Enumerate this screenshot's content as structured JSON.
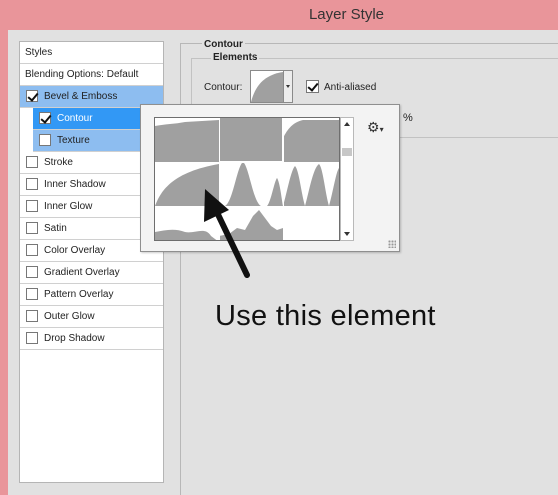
{
  "window": {
    "title": "Layer Style"
  },
  "sidebar": {
    "header": "Styles",
    "blending_options": "Blending Options: Default",
    "items": [
      {
        "label": "Bevel & Emboss",
        "checked": true,
        "selected": true,
        "indent": false
      },
      {
        "label": "Contour",
        "checked": true,
        "selected": true,
        "indent": true
      },
      {
        "label": "Texture",
        "checked": false,
        "selected": true,
        "indent": true
      },
      {
        "label": "Stroke",
        "checked": false,
        "selected": false,
        "indent": false
      },
      {
        "label": "Inner Shadow",
        "checked": false,
        "selected": false,
        "indent": false
      },
      {
        "label": "Inner Glow",
        "checked": false,
        "selected": false,
        "indent": false
      },
      {
        "label": "Satin",
        "checked": false,
        "selected": false,
        "indent": false
      },
      {
        "label": "Color Overlay",
        "checked": false,
        "selected": false,
        "indent": false
      },
      {
        "label": "Gradient Overlay",
        "checked": false,
        "selected": false,
        "indent": false
      },
      {
        "label": "Pattern Overlay",
        "checked": false,
        "selected": false,
        "indent": false
      },
      {
        "label": "Outer Glow",
        "checked": false,
        "selected": false,
        "indent": false
      },
      {
        "label": "Drop Shadow",
        "checked": false,
        "selected": false,
        "indent": false
      }
    ]
  },
  "contour_panel": {
    "group_title": "Contour",
    "subgroup_title": "Elements",
    "contour_label": "Contour:",
    "anti_aliased_label": "Anti-aliased",
    "anti_aliased_checked": true,
    "range_unit": "%"
  },
  "annotation": {
    "text": "Use this element"
  },
  "colors": {
    "window_frame": "#e9959a",
    "panel_bg": "#e1e1e1",
    "selection_light": "#8dbdf0",
    "selection_active": "#3298f5",
    "contour_fill": "#a0a0a0"
  }
}
